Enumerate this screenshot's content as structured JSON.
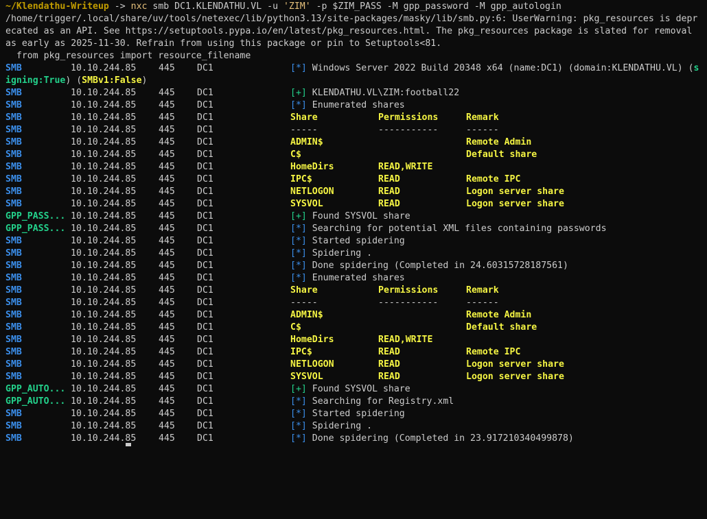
{
  "prompt": {
    "path": "~/Klendathu-Writeup",
    "arrow": " -> ",
    "command": "nxc",
    "args_pre": " smb DC1.KLENDATHU.VL -u ",
    "quoted": "'ZIM'",
    "args_post": " -p $ZIM_PASS -M gpp_password -M gpp_autologin"
  },
  "warning": {
    "line1": "/home/trigger/.local/share/uv/tools/netexec/lib/python3.13/site-packages/masky/lib/smb.py:6: UserWarning: pkg_resources is depr",
    "line2": "ecated as an API. See https://setuptools.pypa.io/en/latest/pkg_resources.html. The pkg_resources package is slated for removal",
    "line3": "as early as 2025-11-30. Refrain from using this package or pin to Setuptools<81.",
    "line4": "  from pkg_resources import resource_filename"
  },
  "host": {
    "ip": "10.10.244.85",
    "port": "445",
    "name": "DC1"
  },
  "banner": {
    "proto": "SMB",
    "tag": "[*]",
    "text": " Windows Server 2022 Build 20348 x64 (name:DC1) (domain:KLENDATHU.VL) (",
    "signing_s": "s",
    "signing_rest": "igning:True",
    "mid": ") (",
    "smbv1": "SMBv1:False",
    "end": ")"
  },
  "auth": {
    "tag": "[+]",
    "text": " KLENDATHU.VL\\ZIM:football22"
  },
  "share_header": {
    "share": "Share",
    "perm": "Permissions",
    "remark": "Remark"
  },
  "share_sep": {
    "share": "-----",
    "perm": "-----------",
    "remark": "------"
  },
  "enum_msg": {
    "tag": "[*]",
    "text": " Enumerated shares"
  },
  "shares": [
    {
      "share": "ADMIN$",
      "perm": "",
      "remark": "Remote Admin"
    },
    {
      "share": "C$",
      "perm": "",
      "remark": "Default share"
    },
    {
      "share": "HomeDirs",
      "perm": "READ,WRITE",
      "remark": ""
    },
    {
      "share": "IPC$",
      "perm": "READ",
      "remark": "Remote IPC"
    },
    {
      "share": "NETLOGON",
      "perm": "READ",
      "remark": "Logon server share"
    },
    {
      "share": "SYSVOL",
      "perm": "READ",
      "remark": "Logon server share"
    }
  ],
  "gpp_pass": {
    "proto": "GPP_PASS...",
    "found": {
      "tag": "[+]",
      "text": " Found SYSVOL share"
    },
    "search": {
      "tag": "[*]",
      "text": " Searching for potential XML files containing passwords"
    }
  },
  "spider1": {
    "proto": "SMB",
    "started": {
      "tag": "[*]",
      "text": " Started spidering"
    },
    "spidering": {
      "tag": "[*]",
      "text": " Spidering ."
    },
    "done": {
      "tag": "[*]",
      "text": " Done spidering (Completed in 24.60315728187561)"
    }
  },
  "gpp_auto": {
    "proto": "GPP_AUTO...",
    "found": {
      "tag": "[+]",
      "text": " Found SYSVOL share"
    },
    "search": {
      "tag": "[*]",
      "text": " Searching for Registry.xml"
    }
  },
  "spider2": {
    "proto": "SMB",
    "started": {
      "tag": "[*]",
      "text": " Started spidering"
    },
    "spidering": {
      "tag": "[*]",
      "text": " Spidering ."
    },
    "done": {
      "tag": "[*]",
      "text": " Done spidering (Completed in 23.917210340499878)"
    }
  },
  "colors": {
    "background": "#0c0c0c",
    "smb": "#3b8eea",
    "gpp": "#23d18b",
    "highlight": "#f5f543",
    "prompt_path": "#c19c00"
  }
}
